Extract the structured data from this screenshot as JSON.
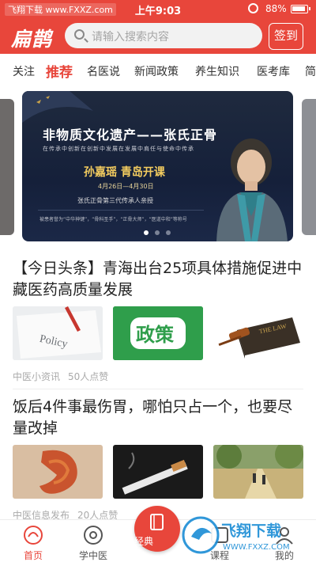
{
  "status": {
    "carrier": "飞翔下载 www.FXXZ.com",
    "time": "上午9:03",
    "battery": "88%"
  },
  "header": {
    "logo": "扁鹊",
    "search_placeholder": "请输入搜索内容",
    "signin": "签到"
  },
  "tabs": [
    {
      "label": "关注",
      "active": false
    },
    {
      "label": "推荐",
      "active": true
    },
    {
      "label": "名医说",
      "active": false
    },
    {
      "label": "新闻政策",
      "active": false
    },
    {
      "label": "养生知识",
      "active": false
    },
    {
      "label": "医考库",
      "active": false
    },
    {
      "label": "简",
      "active": false
    }
  ],
  "banner": {
    "title": "非物质文化遗产——张氏正骨",
    "slogan": "在传承中创新在创新中发展在发展中肩任与使命中传承",
    "speaker": "孙嘉瑶   青岛开课",
    "date": "4月26日—4月30日",
    "sub": "张氏正骨第三代传承人亲授",
    "foot": "被患者誉为“中华神键”，“骨科圣手”，“正骨大师”，“医道中和”等称号",
    "active_index": 0,
    "count": 3
  },
  "articles": [
    {
      "title": "【今日头条】青海出台25项具体措施促进中藏医药高质量发展",
      "source": "中医小资讯",
      "likes": "50人点赞",
      "thumbs": [
        "policy-paper",
        "policy-green",
        "law-book"
      ],
      "thumb_texts": [
        "Policy",
        "政策",
        "THE LAW"
      ]
    },
    {
      "title": "饭后4件事最伤胃，哪怕只占一个，也要尽量改掉",
      "source": "中医信息发布",
      "likes": "20人点赞",
      "thumbs": [
        "stomach",
        "cigarette",
        "park-walk"
      ]
    }
  ],
  "bottom_nav": [
    {
      "label": "首页",
      "icon": "home-icon",
      "active": true
    },
    {
      "label": "学中医",
      "icon": "learn-icon",
      "active": false
    },
    {
      "label": "经典",
      "icon": "classic-book-icon",
      "active": false
    },
    {
      "label": "课程",
      "icon": "course-icon",
      "active": false
    },
    {
      "label": "我的",
      "icon": "profile-icon",
      "active": false
    }
  ],
  "watermark": {
    "main": "飞翔下载",
    "url": "WWW.FXXZ.COM"
  },
  "colors": {
    "brand": "#e8463b",
    "banner_bg": "#1b2640",
    "gold": "#f3cc5f"
  }
}
